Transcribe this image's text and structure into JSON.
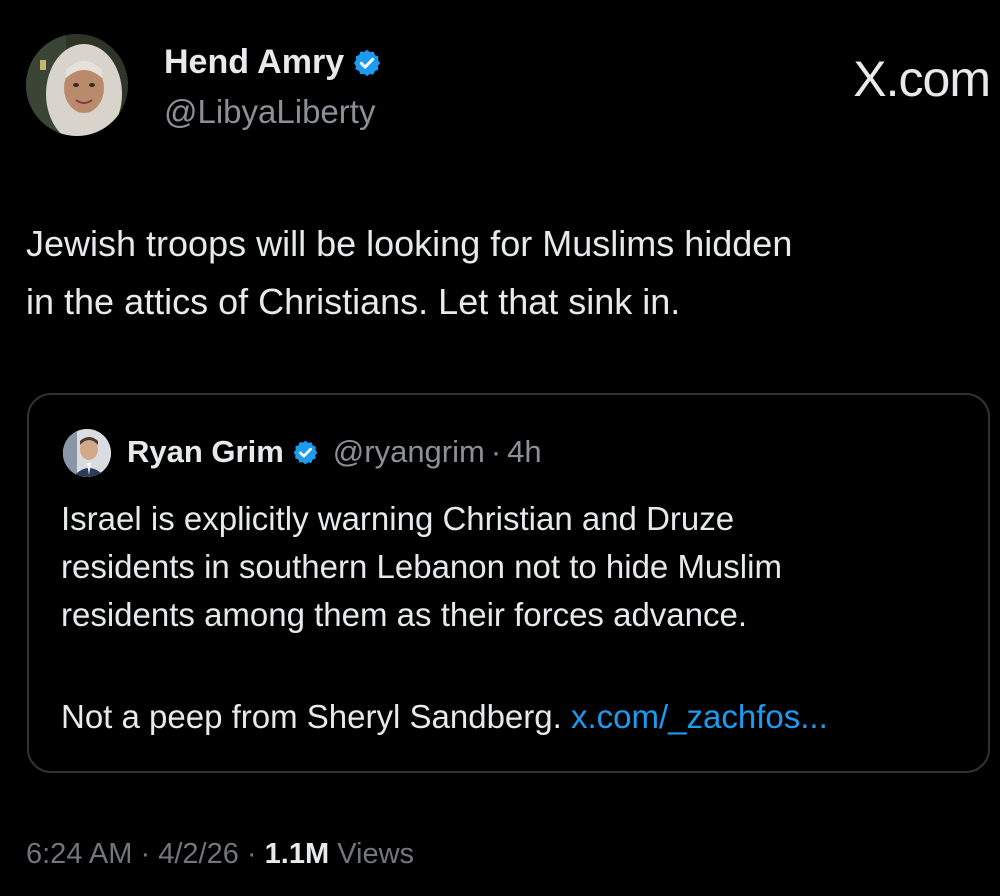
{
  "author": {
    "name": "Hend Amry",
    "handle": "@LibyaLiberty",
    "verified": true
  },
  "brand_label": "X.com",
  "tweet": {
    "text_line1": "Jewish troops will be looking for Muslims hidden",
    "text_line2": "in the attics of Christians. Let that sink in."
  },
  "quoted": {
    "name": "Ryan Grim",
    "handle": "@ryangrim",
    "separator": "·",
    "time": "4h",
    "verified": true,
    "line1": "Israel is explicitly warning Christian and Druze",
    "line2": "residents in southern Lebanon not to hide Muslim",
    "line3": "residents among them as their forces advance.",
    "line4_text": "Not a peep from Sheryl Sandberg.",
    "line4_link": "x.com/_zachfos..."
  },
  "meta": {
    "time": "6:24 AM",
    "sep1": "·",
    "date": "4/2/26",
    "sep2": "·",
    "views_count": "1.1M",
    "views_label": "Views"
  },
  "colors": {
    "background": "#000000",
    "text": "#e7e9ea",
    "secondary": "#8b9097",
    "link": "#1d9bf0",
    "badge": "#1d9bf0",
    "border": "#2f3336"
  },
  "icons": {
    "verified": "verified-badge-icon",
    "author_avatar": "author-avatar",
    "quoted_avatar": "quoted-author-avatar"
  }
}
